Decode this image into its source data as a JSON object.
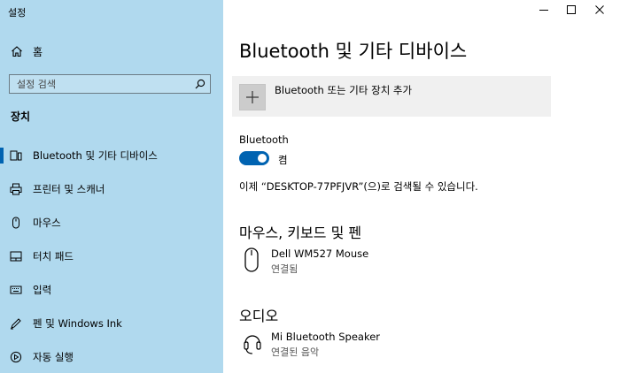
{
  "window": {
    "title": "설정",
    "controls": {
      "minimize": "—",
      "maximize": "☐",
      "close": "✕"
    }
  },
  "sidebar": {
    "home_label": "홈",
    "search_placeholder": "설정 검색",
    "section_title": "장치",
    "items": [
      {
        "label": "Bluetooth 및 기타 디바이스",
        "icon": "bluetooth-devices-icon",
        "selected": true
      },
      {
        "label": "프린터 및 스캐너",
        "icon": "printer-icon",
        "selected": false
      },
      {
        "label": "마우스",
        "icon": "mouse-icon",
        "selected": false
      },
      {
        "label": "터치 패드",
        "icon": "touchpad-icon",
        "selected": false
      },
      {
        "label": "입력",
        "icon": "keyboard-icon",
        "selected": false
      },
      {
        "label": "펜 및 Windows Ink",
        "icon": "pen-icon",
        "selected": false
      },
      {
        "label": "자동 실행",
        "icon": "autoplay-icon",
        "selected": false
      }
    ]
  },
  "main": {
    "title": "Bluetooth 및 기타 디바이스",
    "add_device_label": "Bluetooth 또는 기타 장치 추가",
    "bluetooth_label": "Bluetooth",
    "toggle_state": "켬",
    "discoverable_text": "이제 “DESKTOP-77PFJVR”(으)로 검색될 수 있습니다.",
    "groups": [
      {
        "title": "마우스, 키보드 및 펜",
        "devices": [
          {
            "name": "Dell WM527 Mouse",
            "status": "연결됨",
            "icon": "mouse-device-icon"
          }
        ]
      },
      {
        "title": "오디오",
        "devices": [
          {
            "name": "Mi Bluetooth Speaker",
            "status": "연결된 음악",
            "icon": "headset-icon"
          }
        ]
      }
    ]
  },
  "colors": {
    "sidebar_bg": "#b0d9ee",
    "accent": "#0063b1",
    "add_button_bg": "#f0f0f0"
  }
}
